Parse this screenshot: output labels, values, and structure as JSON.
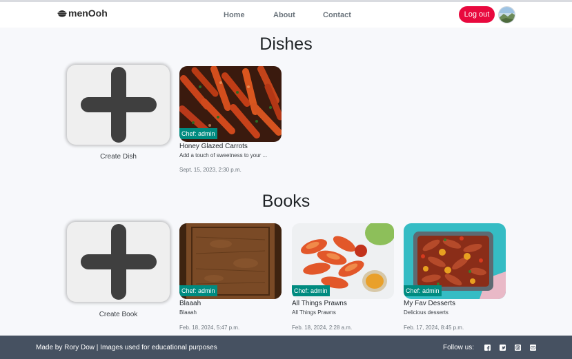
{
  "nav": {
    "brand": "menOoh",
    "links": [
      "Home",
      "About",
      "Contact"
    ],
    "logout": "Log out"
  },
  "dishes": {
    "heading": "Dishes",
    "create_label": "Create Dish",
    "cards": [
      {
        "chef": "Chef: admin",
        "title": "Honey Glazed Carrots",
        "desc": "Add a touch of sweetness to your ...",
        "date": "Sept. 15, 2023, 2:30 p.m."
      }
    ]
  },
  "books": {
    "heading": "Books",
    "create_label": "Create Book",
    "cards": [
      {
        "chef": "Chef: admin",
        "title": "Blaaah",
        "desc": "Blaaah",
        "date": "Feb. 18, 2024, 5:47 p.m."
      },
      {
        "chef": "Chef: admin",
        "title": "All Things Prawns",
        "desc": "All Things Prawns",
        "date": "Feb. 18, 2024, 2:28 a.m."
      },
      {
        "chef": "Chef: admin",
        "title": "My Fav Desserts",
        "desc": "Delicious desserts",
        "date": "Feb. 17, 2024, 8:45 p.m."
      }
    ]
  },
  "footer": {
    "credit": "Made by Rory Dow | Images used for educational purposes",
    "follow": "Follow us:",
    "social_icons": [
      "facebook-icon",
      "twitter-icon",
      "instagram-icon",
      "youtube-icon"
    ]
  },
  "colors": {
    "logout": "#e8093e",
    "badge": "#008b80",
    "footer": "#465161"
  }
}
